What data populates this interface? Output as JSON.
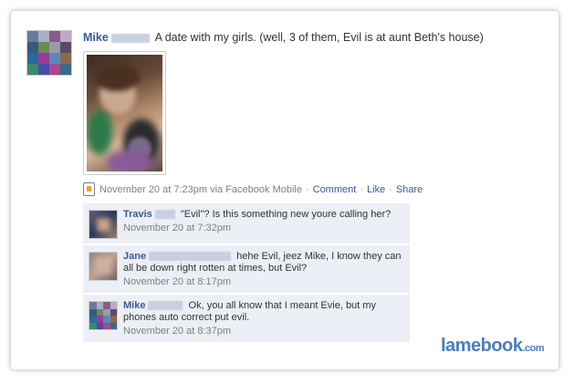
{
  "post": {
    "author": "Mike",
    "text": "A date with my girls. (well, 3 of them, Evil is at aunt Beth's house)",
    "meta": {
      "time": "November 20 at 7:23pm via Facebook Mobile",
      "comment": "Comment",
      "like": "Like",
      "share": "Share",
      "sep": "·"
    }
  },
  "comments": [
    {
      "author": "Travis",
      "text": "\"Evil\"? Is this something new youre calling her?",
      "time": "November 20 at 7:32pm"
    },
    {
      "author": "Jane",
      "text": "hehe Evil, jeez Mike, I know they can all be down right rotten at times, but Evil?",
      "time": "November 20 at 8:17pm"
    },
    {
      "author": "Mike",
      "text": "Ok, you all know that I meant Evie, but my phones auto correct put evil.",
      "time": "November 20 at 8:37pm"
    }
  ],
  "watermark": {
    "name": "lamebook",
    "suffix": ".com"
  },
  "colors": {
    "link": "#3b5998",
    "comment_bg": "#eceff5",
    "meta": "#808080",
    "logo": "#4a7dbf"
  }
}
